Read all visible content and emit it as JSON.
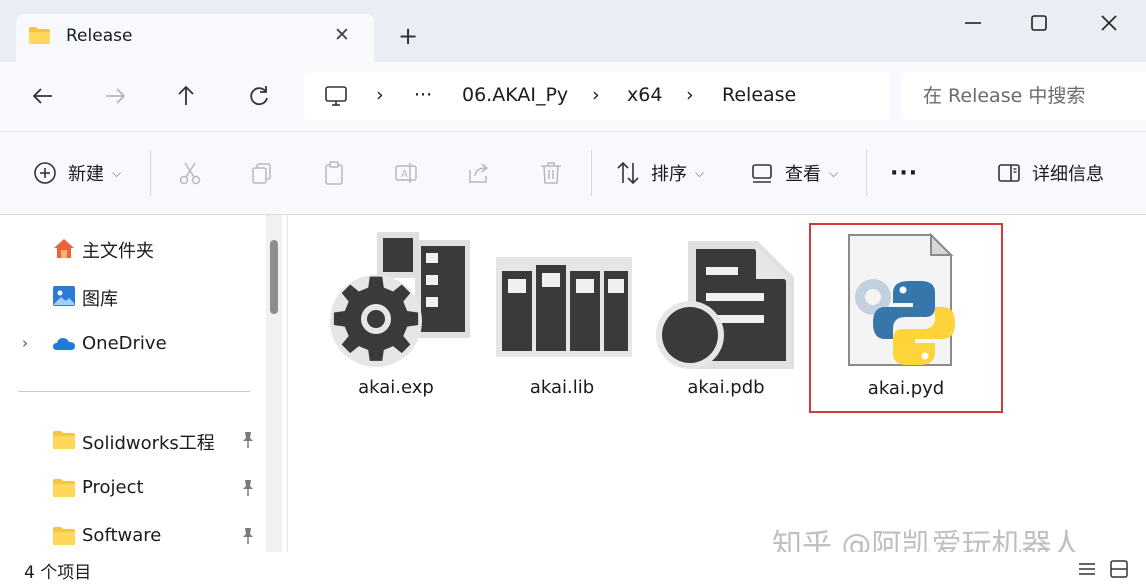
{
  "window": {
    "tab_title": "Release",
    "tab_close": "✕",
    "new_tab": "+"
  },
  "address": {
    "overflow": "···",
    "crumbs": [
      "06.AKAI_Py",
      "x64",
      "Release"
    ],
    "separator": "›"
  },
  "search": {
    "placeholder": "在 Release 中搜索"
  },
  "toolbar": {
    "new_label": "新建",
    "sort_label": "排序",
    "view_label": "查看",
    "more_label": "···",
    "details_label": "详细信息",
    "chevron": "⌵"
  },
  "sidebar": {
    "items": [
      {
        "label": "主文件夹",
        "icon": "home-icon"
      },
      {
        "label": "图库",
        "icon": "gallery-icon"
      },
      {
        "label": "OneDrive",
        "icon": "onedrive-icon"
      },
      {
        "label": "Solidworks工程",
        "icon": "folder-icon"
      },
      {
        "label": "Project",
        "icon": "folder-icon"
      },
      {
        "label": "Software",
        "icon": "folder-icon"
      }
    ],
    "expander": "›"
  },
  "files": [
    {
      "name": "akai.exp",
      "icon": "exp-file-icon"
    },
    {
      "name": "akai.lib",
      "icon": "lib-file-icon"
    },
    {
      "name": "akai.pdb",
      "icon": "pdb-file-icon"
    },
    {
      "name": "akai.pyd",
      "icon": "python-file-icon",
      "selected": true
    }
  ],
  "status": {
    "item_count": "4 个项目"
  },
  "watermark": "知乎 @阿凯爱玩机器人",
  "colors": {
    "accent_selection": "#d23a3a",
    "folder_yellow": "#f4c542",
    "python_blue": "#3776ab",
    "python_yellow": "#ffd43b",
    "onedrive_blue": "#1d7ad6"
  }
}
